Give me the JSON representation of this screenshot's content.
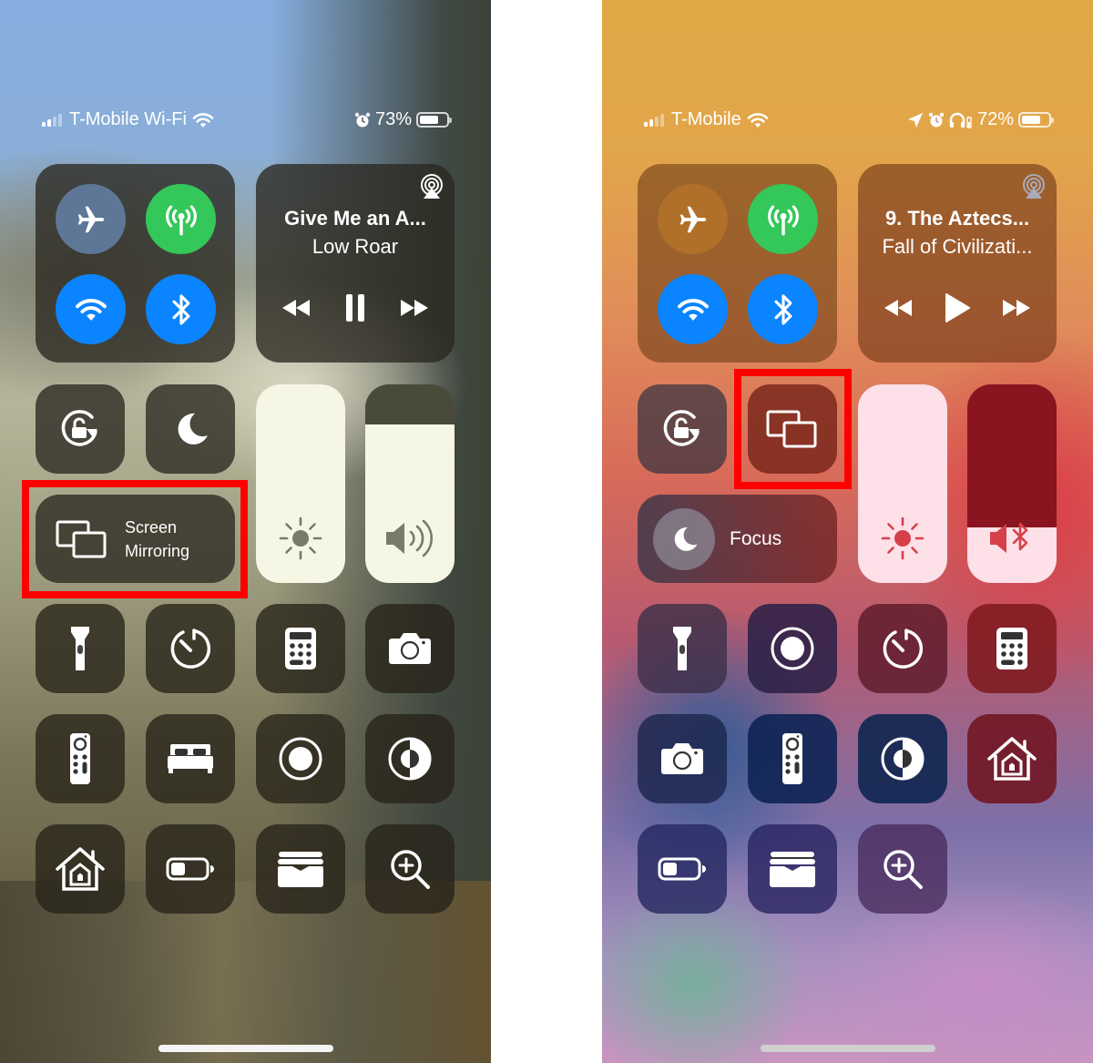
{
  "left_phone": {
    "status_bar": {
      "carrier": "T-Mobile Wi-Fi",
      "signal_bars_active": 2,
      "signal_bars_total": 4,
      "icons": [
        "signal-icon",
        "wifi-icon",
        "alarm-icon",
        "battery-icon"
      ],
      "battery_percent": "73%",
      "battery_level": 0.73
    },
    "connectivity": [
      {
        "name": "airplane-mode",
        "icon": "airplane-icon",
        "state": "off",
        "color": "#5f7796"
      },
      {
        "name": "cellular-data",
        "icon": "antenna-icon",
        "state": "on",
        "color": "#34c759"
      },
      {
        "name": "wifi",
        "icon": "wifi-icon",
        "state": "on",
        "color": "#0a84ff"
      },
      {
        "name": "bluetooth",
        "icon": "bluetooth-icon",
        "state": "on",
        "color": "#0a84ff"
      }
    ],
    "now_playing": {
      "title": "Give Me an A...",
      "artist": "Low Roar",
      "state": "playing",
      "controls": [
        "rewind-icon",
        "pause-icon",
        "fast-forward-icon"
      ]
    },
    "row2_tiles": [
      {
        "name": "orientation-lock",
        "icon": "rotation-lock-icon"
      },
      {
        "name": "do-not-disturb",
        "icon": "moon-icon"
      }
    ],
    "pill": {
      "name": "screen-mirroring",
      "icon": "screen-mirroring-icon",
      "label_line1": "Screen",
      "label_line2": "Mirroring",
      "highlighted": true
    },
    "brightness": {
      "level": 1.0,
      "icon": "sun-icon"
    },
    "volume": {
      "level": 0.8,
      "icon": "speaker-icon"
    },
    "grid": [
      {
        "name": "flashlight",
        "icon": "flashlight-icon"
      },
      {
        "name": "timer",
        "icon": "timer-icon"
      },
      {
        "name": "calculator",
        "icon": "calculator-icon"
      },
      {
        "name": "camera",
        "icon": "camera-icon"
      },
      {
        "name": "apple-tv-remote",
        "icon": "remote-icon"
      },
      {
        "name": "sleep",
        "icon": "bed-icon"
      },
      {
        "name": "screen-recording",
        "icon": "record-icon"
      },
      {
        "name": "dark-mode",
        "icon": "contrast-icon"
      },
      {
        "name": "home",
        "icon": "home-icon"
      },
      {
        "name": "low-power-mode",
        "icon": "battery-icon"
      },
      {
        "name": "wallet",
        "icon": "wallet-icon"
      },
      {
        "name": "magnifier",
        "icon": "magnifier-icon"
      }
    ]
  },
  "right_phone": {
    "status_bar": {
      "carrier": "T-Mobile",
      "signal_bars_active": 2,
      "signal_bars_total": 4,
      "icons": [
        "signal-icon",
        "wifi-icon",
        "location-icon",
        "alarm-icon",
        "headphones-icon",
        "battery-icon"
      ],
      "battery_percent": "72%",
      "battery_level": 0.72
    },
    "connectivity": [
      {
        "name": "airplane-mode",
        "icon": "airplane-icon",
        "state": "off",
        "color": "#b0702a"
      },
      {
        "name": "cellular-data",
        "icon": "antenna-icon",
        "state": "on",
        "color": "#34c759"
      },
      {
        "name": "wifi",
        "icon": "wifi-icon",
        "state": "on",
        "color": "#0a84ff"
      },
      {
        "name": "bluetooth",
        "icon": "bluetooth-icon",
        "state": "on",
        "color": "#0a84ff"
      }
    ],
    "now_playing": {
      "title": "9. The Aztecs...",
      "artist": "Fall of Civilizati...",
      "state": "paused",
      "controls": [
        "rewind-icon",
        "play-icon",
        "fast-forward-icon"
      ]
    },
    "row2_tiles": [
      {
        "name": "orientation-lock",
        "icon": "rotation-lock-icon"
      },
      {
        "name": "screen-mirroring",
        "icon": "screen-mirroring-icon",
        "highlighted": true
      }
    ],
    "pill": {
      "name": "focus",
      "icon": "moon-icon",
      "label": "Focus"
    },
    "brightness": {
      "level": 1.0,
      "icon": "sun-icon"
    },
    "volume": {
      "level": 0.28,
      "icon": "speaker-bluetooth-icon"
    },
    "grid": [
      {
        "name": "flashlight",
        "icon": "flashlight-icon"
      },
      {
        "name": "screen-recording",
        "icon": "record-icon"
      },
      {
        "name": "timer",
        "icon": "timer-icon"
      },
      {
        "name": "calculator",
        "icon": "calculator-icon"
      },
      {
        "name": "camera",
        "icon": "camera-icon"
      },
      {
        "name": "apple-tv-remote",
        "icon": "remote-icon"
      },
      {
        "name": "dark-mode",
        "icon": "contrast-icon"
      },
      {
        "name": "home",
        "icon": "home-icon"
      },
      {
        "name": "low-power-mode",
        "icon": "battery-icon"
      },
      {
        "name": "wallet",
        "icon": "wallet-icon"
      },
      {
        "name": "magnifier",
        "icon": "magnifier-icon"
      }
    ]
  },
  "colors": {
    "highlight": "#ff0000",
    "green": "#34c759",
    "blue": "#0a84ff",
    "left_slider_fill": "#f6f6e4",
    "left_slider_track": "#4a4a3a",
    "right_slider_fill": "#fde0e8",
    "right_volume_track": "#8a1420",
    "left_slider_icon": "#7a7a68",
    "right_slider_icon": "#d6404a"
  }
}
